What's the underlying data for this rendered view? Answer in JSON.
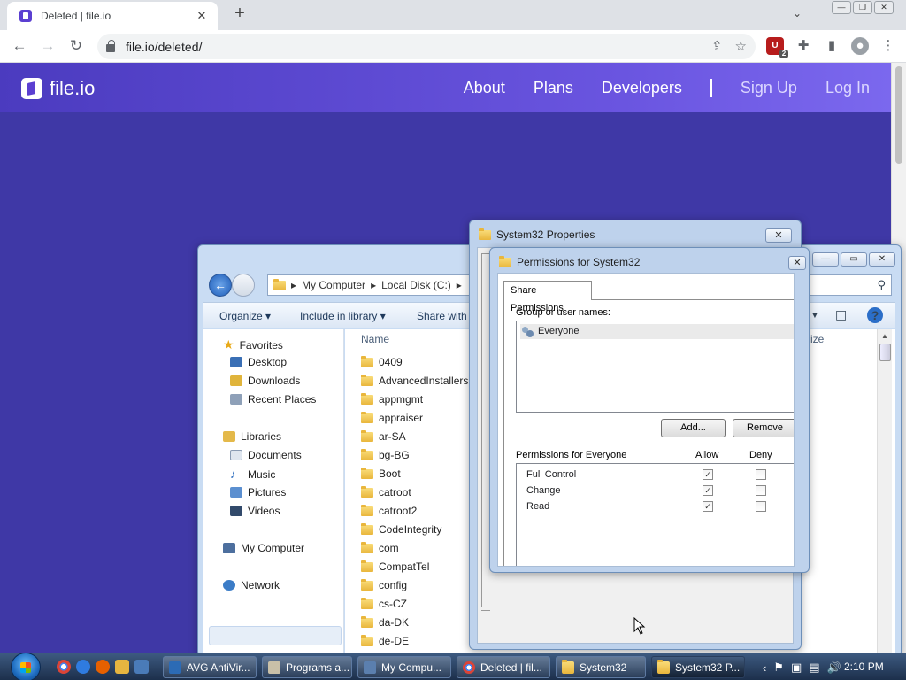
{
  "browser": {
    "tab_title": "Deleted | file.io",
    "tab_close": "✕",
    "new_tab": "+",
    "tab_dropdown": "⌄",
    "url": "file.io/deleted/",
    "window_controls": [
      "—",
      "❐",
      "✕"
    ]
  },
  "site": {
    "logo_text": "file.io",
    "nav": {
      "about": "About",
      "plans": "Plans",
      "developers": "Developers",
      "sign_up": "Sign Up",
      "log_in": "Log In"
    },
    "colors": {
      "header_start": "#4b3bbf",
      "header_end": "#7b68ee",
      "body": "#3f38a6"
    }
  },
  "explorer": {
    "breadcrumb": [
      "My Computer",
      "Local Disk (C:)"
    ],
    "search_icon": "search-icon",
    "commands": {
      "organize": "Organize ▾",
      "include_in_library": "Include in library ▾",
      "share_with": "Share with"
    },
    "columns": {
      "name": "Name",
      "size": "Size"
    },
    "nav_pane": {
      "favorites": "Favorites",
      "favorites_items": [
        "Desktop",
        "Downloads",
        "Recent Places"
      ],
      "libraries": "Libraries",
      "libraries_items": [
        "Documents",
        "Music",
        "Pictures",
        "Videos"
      ],
      "my_computer": "My Computer",
      "network": "Network"
    },
    "files": [
      "0409",
      "AdvancedInstallers",
      "appmgmt",
      "appraiser",
      "ar-SA",
      "bg-BG",
      "Boot",
      "catroot",
      "catroot2",
      "CodeIntegrity",
      "com",
      "CompatTel",
      "config",
      "cs-CZ",
      "da-DK",
      "de-DE"
    ]
  },
  "properties_dialog": {
    "title": "System32 Properties",
    "close": "✕"
  },
  "permissions_dialog": {
    "title": "Permissions for System32",
    "close": "✕",
    "tab": "Share Permissions",
    "group_label": "Group or user names:",
    "users": [
      "Everyone"
    ],
    "add_button": "Add...",
    "remove_button": "Remove",
    "permissions_label": "Permissions for Everyone",
    "allow_header": "Allow",
    "deny_header": "Deny",
    "permissions": [
      {
        "name": "Full Control",
        "allow": true,
        "deny": false
      },
      {
        "name": "Change",
        "allow": true,
        "deny": false
      },
      {
        "name": "Read",
        "allow": true,
        "deny": false
      }
    ]
  },
  "taskbar": {
    "buttons": [
      "AVG AntiVir...",
      "Programs a...",
      "My Compu...",
      "Deleted | fil...",
      "System32",
      "System32 P..."
    ],
    "clock": "2:10 PM"
  }
}
